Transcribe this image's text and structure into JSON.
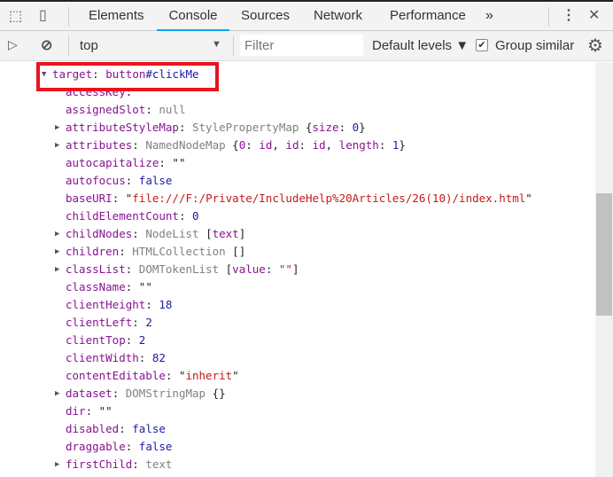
{
  "tabs": {
    "items": [
      {
        "label": "Elements"
      },
      {
        "label": "Console",
        "active": true
      },
      {
        "label": "Sources"
      },
      {
        "label": "Network"
      },
      {
        "label": "Performance"
      }
    ],
    "more": "»"
  },
  "toolbar": {
    "context": "top",
    "filter_placeholder": "Filter",
    "levels": "Default levels ▼",
    "group_similar": "Group similar",
    "group_similar_checked": true
  },
  "colors": {
    "accent": "#03a9f4",
    "highlight_box": "#e8141f",
    "key": "#881391",
    "string": "#c41a16",
    "number": "#1a1aa6"
  },
  "console": {
    "rows": [
      {
        "expand": "open",
        "parts": [
          [
            "target",
            "k"
          ],
          [
            ": ",
            "p"
          ],
          [
            "button",
            "k"
          ],
          [
            "#clickMe",
            "b"
          ]
        ]
      },
      {
        "expand": "none",
        "parts": [
          [
            "accessKey",
            "k"
          ],
          [
            ": ",
            "p"
          ],
          [
            "\"\"",
            "e"
          ]
        ]
      },
      {
        "expand": "none",
        "parts": [
          [
            "assignedSlot",
            "k"
          ],
          [
            ": ",
            "p"
          ],
          [
            "null",
            "g"
          ]
        ]
      },
      {
        "expand": "closed",
        "parts": [
          [
            "attributeStyleMap",
            "k"
          ],
          [
            ": ",
            "p"
          ],
          [
            "StylePropertyMap ",
            "n"
          ],
          [
            "{",
            "e"
          ],
          [
            "size",
            "k"
          ],
          [
            ": ",
            "p"
          ],
          [
            "0",
            "b"
          ],
          [
            "}",
            "e"
          ]
        ]
      },
      {
        "expand": "closed",
        "parts": [
          [
            "attributes",
            "k"
          ],
          [
            ": ",
            "p"
          ],
          [
            "NamedNodeMap ",
            "n"
          ],
          [
            "{",
            "e"
          ],
          [
            "0",
            "k"
          ],
          [
            ": ",
            "p"
          ],
          [
            "id",
            "k"
          ],
          [
            ", ",
            "e"
          ],
          [
            "id",
            "k"
          ],
          [
            ": ",
            "p"
          ],
          [
            "id",
            "k"
          ],
          [
            ", ",
            "e"
          ],
          [
            "length",
            "k"
          ],
          [
            ": ",
            "p"
          ],
          [
            "1",
            "b"
          ],
          [
            "}",
            "e"
          ]
        ]
      },
      {
        "expand": "none",
        "parts": [
          [
            "autocapitalize",
            "k"
          ],
          [
            ": ",
            "p"
          ],
          [
            "\"\"",
            "e"
          ]
        ]
      },
      {
        "expand": "none",
        "parts": [
          [
            "autofocus",
            "k"
          ],
          [
            ": ",
            "p"
          ],
          [
            "false",
            "b"
          ]
        ]
      },
      {
        "expand": "none",
        "parts": [
          [
            "baseURI",
            "k"
          ],
          [
            ": ",
            "p"
          ],
          [
            "\"",
            "e"
          ],
          [
            "file:///F:/Private/IncludeHelp%20Articles/26(10)/index.html",
            "s"
          ],
          [
            "\"",
            "e"
          ]
        ]
      },
      {
        "expand": "none",
        "parts": [
          [
            "childElementCount",
            "k"
          ],
          [
            ": ",
            "p"
          ],
          [
            "0",
            "b"
          ]
        ]
      },
      {
        "expand": "closed",
        "parts": [
          [
            "childNodes",
            "k"
          ],
          [
            ": ",
            "p"
          ],
          [
            "NodeList ",
            "n"
          ],
          [
            "[",
            "e"
          ],
          [
            "text",
            "k"
          ],
          [
            "]",
            "e"
          ]
        ]
      },
      {
        "expand": "closed",
        "parts": [
          [
            "children",
            "k"
          ],
          [
            ": ",
            "p"
          ],
          [
            "HTMLCollection ",
            "n"
          ],
          [
            "[]",
            "e"
          ]
        ]
      },
      {
        "expand": "closed",
        "parts": [
          [
            "classList",
            "k"
          ],
          [
            ": ",
            "p"
          ],
          [
            "DOMTokenList ",
            "n"
          ],
          [
            "[",
            "e"
          ],
          [
            "value",
            "k"
          ],
          [
            ": ",
            "p"
          ],
          [
            "\"\"",
            "s"
          ],
          [
            "]",
            "e"
          ]
        ]
      },
      {
        "expand": "none",
        "parts": [
          [
            "className",
            "k"
          ],
          [
            ": ",
            "p"
          ],
          [
            "\"\"",
            "e"
          ]
        ]
      },
      {
        "expand": "none",
        "parts": [
          [
            "clientHeight",
            "k"
          ],
          [
            ": ",
            "p"
          ],
          [
            "18",
            "b"
          ]
        ]
      },
      {
        "expand": "none",
        "parts": [
          [
            "clientLeft",
            "k"
          ],
          [
            ": ",
            "p"
          ],
          [
            "2",
            "b"
          ]
        ]
      },
      {
        "expand": "none",
        "parts": [
          [
            "clientTop",
            "k"
          ],
          [
            ": ",
            "p"
          ],
          [
            "2",
            "b"
          ]
        ]
      },
      {
        "expand": "none",
        "parts": [
          [
            "clientWidth",
            "k"
          ],
          [
            ": ",
            "p"
          ],
          [
            "82",
            "b"
          ]
        ]
      },
      {
        "expand": "none",
        "parts": [
          [
            "contentEditable",
            "k"
          ],
          [
            ": ",
            "p"
          ],
          [
            "\"",
            "e"
          ],
          [
            "inherit",
            "s"
          ],
          [
            "\"",
            "e"
          ]
        ]
      },
      {
        "expand": "closed",
        "parts": [
          [
            "dataset",
            "k"
          ],
          [
            ": ",
            "p"
          ],
          [
            "DOMStringMap ",
            "n"
          ],
          [
            "{}",
            "e"
          ]
        ]
      },
      {
        "expand": "none",
        "parts": [
          [
            "dir",
            "k"
          ],
          [
            ": ",
            "p"
          ],
          [
            "\"\"",
            "e"
          ]
        ]
      },
      {
        "expand": "none",
        "parts": [
          [
            "disabled",
            "k"
          ],
          [
            ": ",
            "p"
          ],
          [
            "false",
            "b"
          ]
        ]
      },
      {
        "expand": "none",
        "parts": [
          [
            "draggable",
            "k"
          ],
          [
            ": ",
            "p"
          ],
          [
            "false",
            "b"
          ]
        ]
      },
      {
        "expand": "closed",
        "parts": [
          [
            "firstChild",
            "k"
          ],
          [
            ": ",
            "p"
          ],
          [
            "text",
            "n"
          ]
        ]
      }
    ]
  }
}
